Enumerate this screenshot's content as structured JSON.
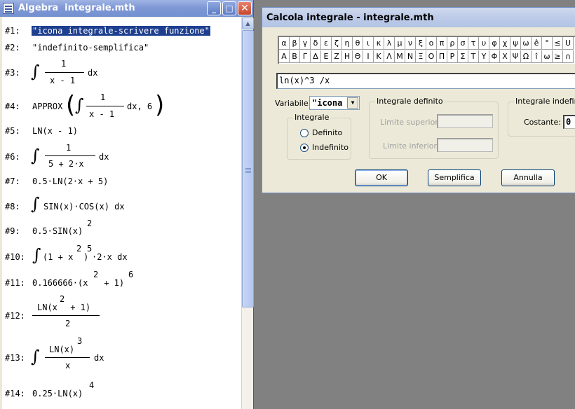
{
  "algebra_window": {
    "title": "Algebra  integrale.mth",
    "controls": {
      "minimize": "_",
      "maximize": "□",
      "close": "✕"
    },
    "expressions": [
      {
        "num": "#1:",
        "text": "\"icona integrale-scrivere funzione\""
      },
      {
        "num": "#2:",
        "text": "\"indefinito-semplifica\""
      },
      {
        "num": "#3:",
        "numer": "1",
        "denom": "x - 1",
        "suffix": "dx"
      },
      {
        "num": "#4:",
        "prefix": "APPROX",
        "numer": "1",
        "denom": "x - 1",
        "suffix": "dx, 6"
      },
      {
        "num": "#5:",
        "text": "LN(x - 1)"
      },
      {
        "num": "#6:",
        "numer": "1",
        "denom": "5 + 2·x",
        "suffix": "dx"
      },
      {
        "num": "#7:",
        "text": "0.5·LN(2·x + 5)"
      },
      {
        "num": "#8:",
        "text": "SIN(x)·COS(x) dx"
      },
      {
        "num": "#9:",
        "base": "0.5·SIN(x)",
        "exp": "2"
      },
      {
        "num": "#10:",
        "pre": "(1 + x",
        "exp1": "2",
        "mid": ")",
        "exp2": "5",
        "post": "·2·x dx"
      },
      {
        "num": "#11:",
        "pre": "0.166666·(x",
        "exp1": "2",
        "mid": " + 1)",
        "exp2": "6"
      },
      {
        "num": "#12:",
        "numer_pre": "LN(x",
        "numer_exp": "2",
        "numer_post": " + 1)",
        "denom": "2"
      },
      {
        "num": "#13:",
        "numer_pre": "LN(x)",
        "numer_exp": "3",
        "denom": "x",
        "suffix": "dx"
      },
      {
        "num": "#14:",
        "base": "0.25·LN(x)",
        "exp": "4"
      }
    ],
    "integral_sign": "∫"
  },
  "dialog": {
    "title": "Calcola integrale - integrale.mth",
    "symbols_row1": [
      "α",
      "β",
      "γ",
      "δ",
      "ε",
      "ζ",
      "η",
      "θ",
      "ι",
      "κ",
      "λ",
      "μ",
      "ν",
      "ξ",
      "ο",
      "π",
      "ρ",
      "σ",
      "τ",
      "υ",
      "φ",
      "χ",
      "ψ",
      "ω",
      "ê",
      "°",
      "≤",
      "U"
    ],
    "symbols_row2": [
      "Α",
      "Β",
      "Γ",
      "Δ",
      "Ε",
      "Ζ",
      "Η",
      "Θ",
      "Ι",
      "Κ",
      "Λ",
      "Μ",
      "Ν",
      "Ξ",
      "Ο",
      "Π",
      "Ρ",
      "Σ",
      "Τ",
      "Υ",
      "Φ",
      "Χ",
      "Ψ",
      "Ω",
      "î",
      "ω",
      "≥",
      "∩"
    ],
    "expression_value": "ln(x)^3 /x",
    "variable_label": "Variabile:",
    "variable_value": "\"icona",
    "integrale_group": "Integrale",
    "radio_definito": "Definito",
    "radio_indefinito": "Indefinito",
    "definite_group": "Integrale definito",
    "upper_limit_label": "Limite superiore:",
    "lower_limit_label": "Limite inferiore:",
    "indefinite_group": "Integrale indefinito",
    "constant_label": "Costante:",
    "constant_value": "0",
    "ok_label": "OK",
    "simplify_label": "Semplifica",
    "cancel_label": "Annulla"
  }
}
